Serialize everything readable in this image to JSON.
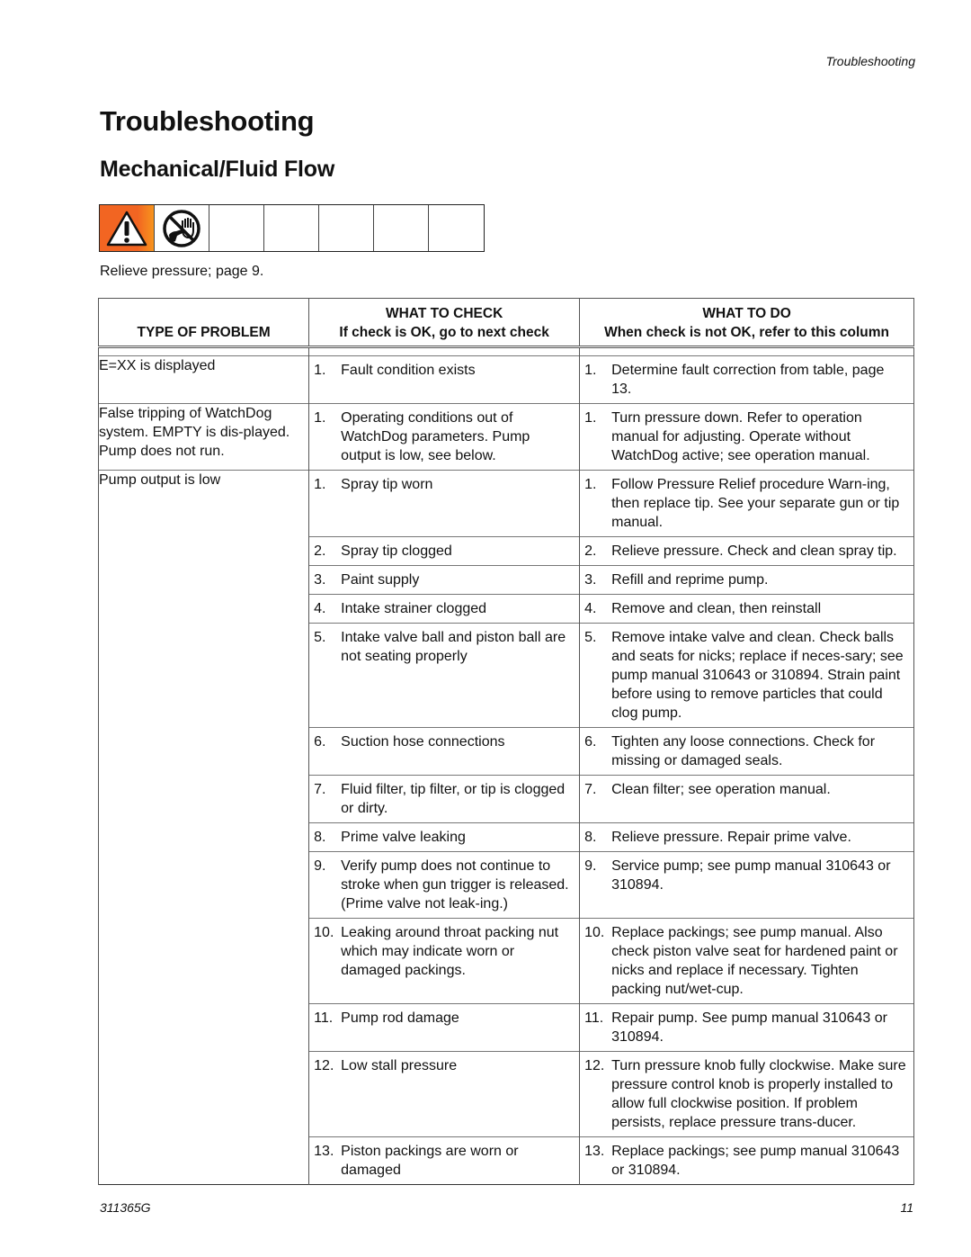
{
  "header": {
    "running_title": "Troubleshooting"
  },
  "page": {
    "title": "Troubleshooting",
    "subtitle": "Mechanical/Fluid Flow",
    "icons": [
      "warning-triangle-icon",
      "no-hand-spray-icon",
      "",
      "",
      "",
      "",
      ""
    ],
    "relieve_note": "Relieve pressure; page 9."
  },
  "table": {
    "headers": {
      "problem": "TYPE OF PROBLEM",
      "check_title": "WHAT TO CHECK",
      "check_sub": "If check is OK, go to next check",
      "do_title": "WHAT TO DO",
      "do_sub": "When check is not OK, refer to this column"
    },
    "rows": [
      {
        "problem": "E=XX is displayed",
        "num": "1.",
        "check": "Fault condition exists",
        "do_num": "1.",
        "do": "Determine fault correction from table, page 13."
      },
      {
        "problem": "False tripping of WatchDog system. EMPTY is dis-played. Pump does not run.",
        "num": "1.",
        "check": "Operating conditions out of WatchDog parameters. Pump output is low, see below.",
        "do_num": "1.",
        "do": "Turn pressure down. Refer to operation manual for adjusting. Operate without WatchDog active; see operation manual."
      },
      {
        "problem": "Pump output is low",
        "num": "1.",
        "check": "Spray tip worn",
        "do_num": "1.",
        "do": "Follow Pressure Relief procedure Warn-ing, then replace tip. See your separate gun or tip manual."
      },
      {
        "problem": "",
        "num": "2.",
        "check": "Spray tip clogged",
        "do_num": "2.",
        "do": "Relieve pressure. Check and clean spray tip."
      },
      {
        "problem": "",
        "num": "3.",
        "check": "Paint supply",
        "do_num": "3.",
        "do": "Refill and reprime pump."
      },
      {
        "problem": "",
        "num": "4.",
        "check": "Intake strainer clogged",
        "do_num": "4.",
        "do": "Remove and clean, then reinstall"
      },
      {
        "problem": "",
        "num": "5.",
        "check": "Intake valve ball and piston ball are not seating properly",
        "do_num": "5.",
        "do": "Remove intake valve and clean. Check balls and seats for nicks; replace if neces-sary; see pump manual 310643 or 310894. Strain paint before using to remove particles that could clog pump."
      },
      {
        "problem": "",
        "num": "6.",
        "check": "Suction hose connections",
        "do_num": "6.",
        "do": "Tighten any loose connections. Check for missing or damaged seals."
      },
      {
        "problem": "",
        "num": "7.",
        "check": "Fluid filter, tip filter, or tip is clogged or dirty.",
        "do_num": "7.",
        "do": "Clean filter; see operation manual."
      },
      {
        "problem": "",
        "num": "8.",
        "check": "Prime valve leaking",
        "do_num": "8.",
        "do": "Relieve pressure. Repair prime valve."
      },
      {
        "problem": "",
        "num": "9.",
        "check": "Verify pump does not continue to stroke when gun trigger is released. (Prime valve not leak-ing.)",
        "do_num": "9.",
        "do": "Service pump; see pump manual 310643 or 310894."
      },
      {
        "problem": "",
        "num": "10.",
        "check": "Leaking around throat packing nut which may indicate worn or damaged packings.",
        "do_num": "10.",
        "do": "Replace packings; see pump manual. Also check piston valve seat for hardened paint or nicks and replace if necessary. Tighten packing nut/wet-cup."
      },
      {
        "problem": "",
        "num": "11.",
        "check": "Pump rod damage",
        "do_num": "11.",
        "do": "Repair pump. See pump manual 310643 or 310894."
      },
      {
        "problem": "",
        "num": "12.",
        "check": "Low stall pressure",
        "do_num": "12.",
        "do": "Turn pressure knob fully clockwise. Make sure pressure control knob is properly installed to allow full clockwise position. If problem persists, replace pressure trans-ducer."
      },
      {
        "problem": "",
        "num": "13.",
        "check": "Piston packings are worn or damaged",
        "do_num": "13.",
        "do": "Replace packings; see pump manual 310643 or 310894."
      }
    ]
  },
  "footer": {
    "doc_number": "311365G",
    "page_number": "11"
  }
}
